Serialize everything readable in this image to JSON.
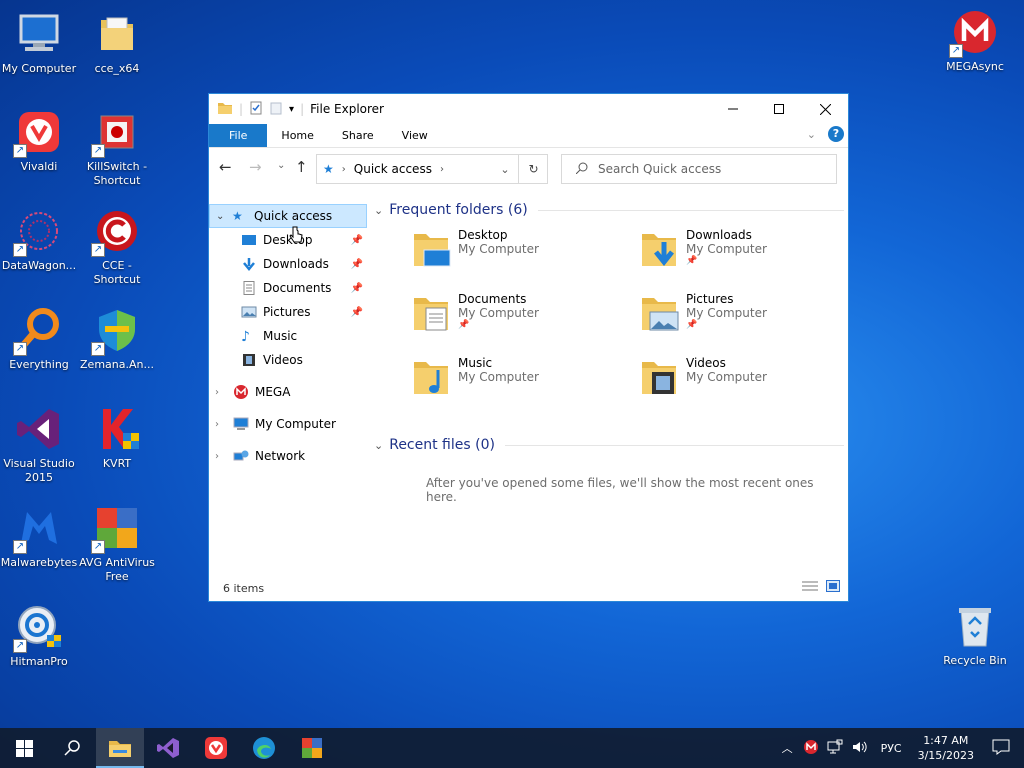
{
  "desktop": {
    "icons": [
      {
        "label": "My Computer"
      },
      {
        "label": "cce_x64"
      },
      {
        "label": "Vivaldi"
      },
      {
        "label": "KillSwitch - Shortcut"
      },
      {
        "label": "DataWagon..."
      },
      {
        "label": "CCE - Shortcut"
      },
      {
        "label": "Everything"
      },
      {
        "label": "Zemana.An..."
      },
      {
        "label": "Visual Studio 2015"
      },
      {
        "label": "KVRT"
      },
      {
        "label": "Malwarebytes"
      },
      {
        "label": "AVG AntiVirus Free"
      },
      {
        "label": "HitmanPro"
      },
      {
        "label": "MEGAsync"
      },
      {
        "label": "Recycle Bin"
      }
    ]
  },
  "window": {
    "title": "File Explorer",
    "tabs": [
      "File",
      "Home",
      "Share",
      "View"
    ],
    "address": {
      "location": "Quick access"
    },
    "search": {
      "placeholder": "Search Quick access"
    },
    "nav": {
      "quick_access": "Quick access",
      "pinned": [
        "Desktop",
        "Downloads",
        "Documents",
        "Pictures"
      ],
      "unpinned": [
        "Music",
        "Videos"
      ],
      "roots": [
        "MEGA",
        "My Computer",
        "Network"
      ]
    },
    "frequent": {
      "header": "Frequent folders (6)",
      "folders": [
        {
          "name": "Desktop",
          "location": "My Computer"
        },
        {
          "name": "Downloads",
          "location": "My Computer"
        },
        {
          "name": "Documents",
          "location": "My Computer"
        },
        {
          "name": "Pictures",
          "location": "My Computer"
        },
        {
          "name": "Music",
          "location": "My Computer"
        },
        {
          "name": "Videos",
          "location": "My Computer"
        }
      ]
    },
    "recent": {
      "header": "Recent files (0)",
      "empty_message": "After you've opened some files, we'll show the most recent ones here."
    },
    "status": "6 items"
  },
  "taskbar": {
    "language": "РУС",
    "time": "1:47 AM",
    "date": "3/15/2023"
  }
}
